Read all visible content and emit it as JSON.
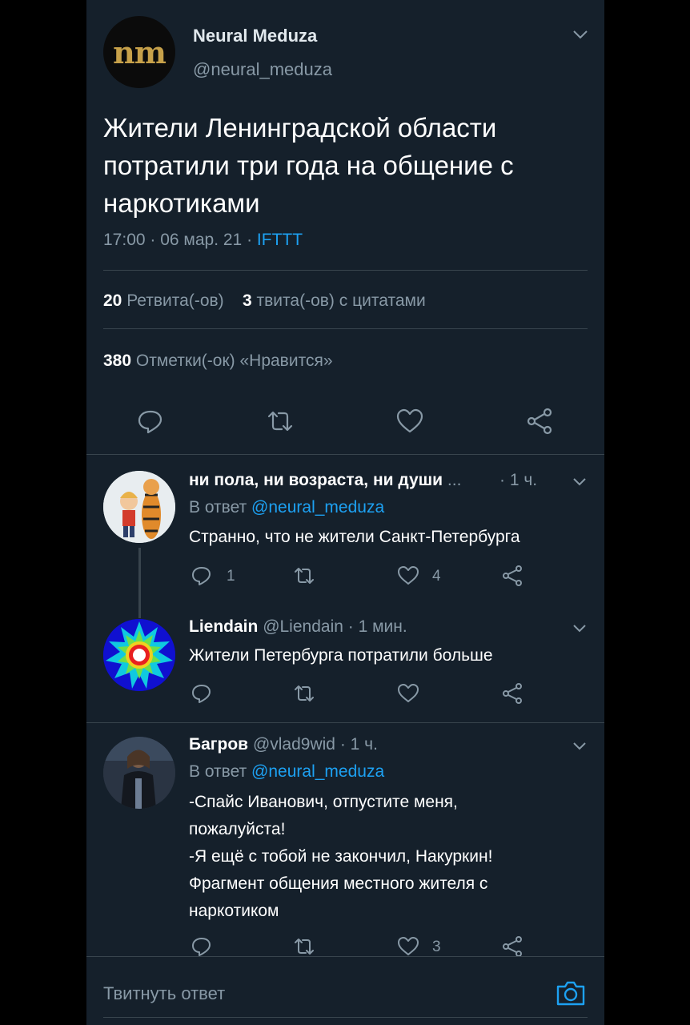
{
  "main_tweet": {
    "avatar_text": "nm",
    "name": "Neural Meduza",
    "handle": "@neural_meduza",
    "text_lines": [
      "Жители Ленинградской области",
      "потратили три года на общение с",
      "наркотиками"
    ],
    "time_date": "17:00 · 06 мар. 21 · ",
    "source": "IFTTT",
    "retweets_count": "20",
    "retweets_label": "Ретвита(-ов)",
    "quotes_count": "3",
    "quotes_label": "твита(-ов) с цитатами",
    "likes_count": "380",
    "likes_label": "Отметки(-ок) «Нравится»",
    "actions": [
      "reply-icon",
      "retweet-icon",
      "like-icon",
      "share-icon"
    ]
  },
  "replies": [
    {
      "name": "ни пола, ни возраста, ни души",
      "ellipsis": " ...",
      "time": "· 1 ч.",
      "reply_to_label": "В ответ ",
      "reply_to_handle": "@neural_meduza",
      "text": "Странно, что не жители Санкт-Петербурга",
      "reply_count": "1",
      "like_count": "4"
    },
    {
      "name": "Liendain",
      "handle": "@Liendain",
      "time": "· 1 мин.",
      "text": "Жители Петербурга потратили больше"
    },
    {
      "name": "Багров",
      "handle": "@vlad9wid",
      "time": "· 1 ч.",
      "reply_to_label": "В ответ ",
      "reply_to_handle": "@neural_meduza",
      "text_lines": [
        "-Спайс Иванович, отпустите меня,",
        "пожалуйста!",
        "-Я ещё с тобой не закончил, Накуркин!",
        "Фрагмент общения местного жителя с",
        "наркотиком"
      ],
      "like_count": "3"
    }
  ],
  "compose": {
    "placeholder": "Твитнуть ответ"
  },
  "colors": {
    "background": "#15202b",
    "muted": "#8899a6",
    "link": "#1da1f2",
    "divider": "#38444d"
  }
}
